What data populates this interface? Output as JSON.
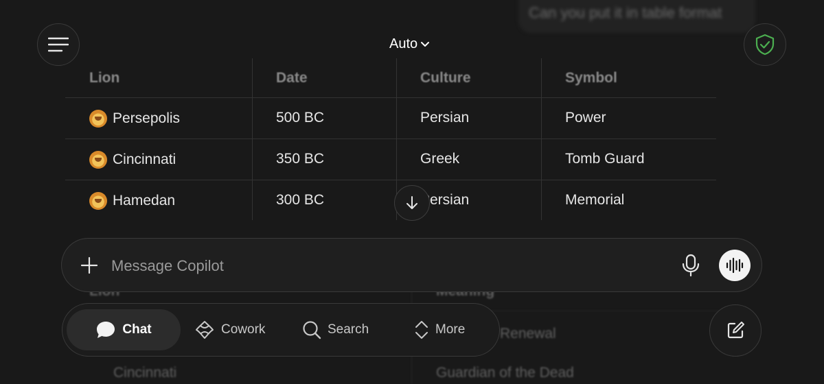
{
  "background_prompt": "Can you put it in table format",
  "header": {
    "model_label": "Auto"
  },
  "table": {
    "headers": [
      "Lion",
      "Date",
      "Culture",
      "Symbol"
    ],
    "rows": [
      {
        "lion": "Persepolis",
        "date": "500 BC",
        "culture": "Persian",
        "symbol": "Power"
      },
      {
        "lion": "Cincinnati",
        "date": "350 BC",
        "culture": "Greek",
        "symbol": "Tomb Guard"
      },
      {
        "lion": "Hamedan",
        "date": "300 BC",
        "culture": "Persian",
        "symbol": "Memorial"
      }
    ]
  },
  "lower_table_faded": {
    "headers": [
      "Lion",
      "Meaning"
    ],
    "meaning_1": "Renewal",
    "lion_2": "Cincinnati",
    "meaning_2": "Guardian of the Dead"
  },
  "composer": {
    "placeholder": "Message Copilot"
  },
  "nav": {
    "chat": "Chat",
    "cowork": "Cowork",
    "search": "Search",
    "more": "More"
  },
  "colors": {
    "background": "#191919",
    "shield_accent": "#4caf50",
    "voice_button": "#f3f3f3"
  }
}
